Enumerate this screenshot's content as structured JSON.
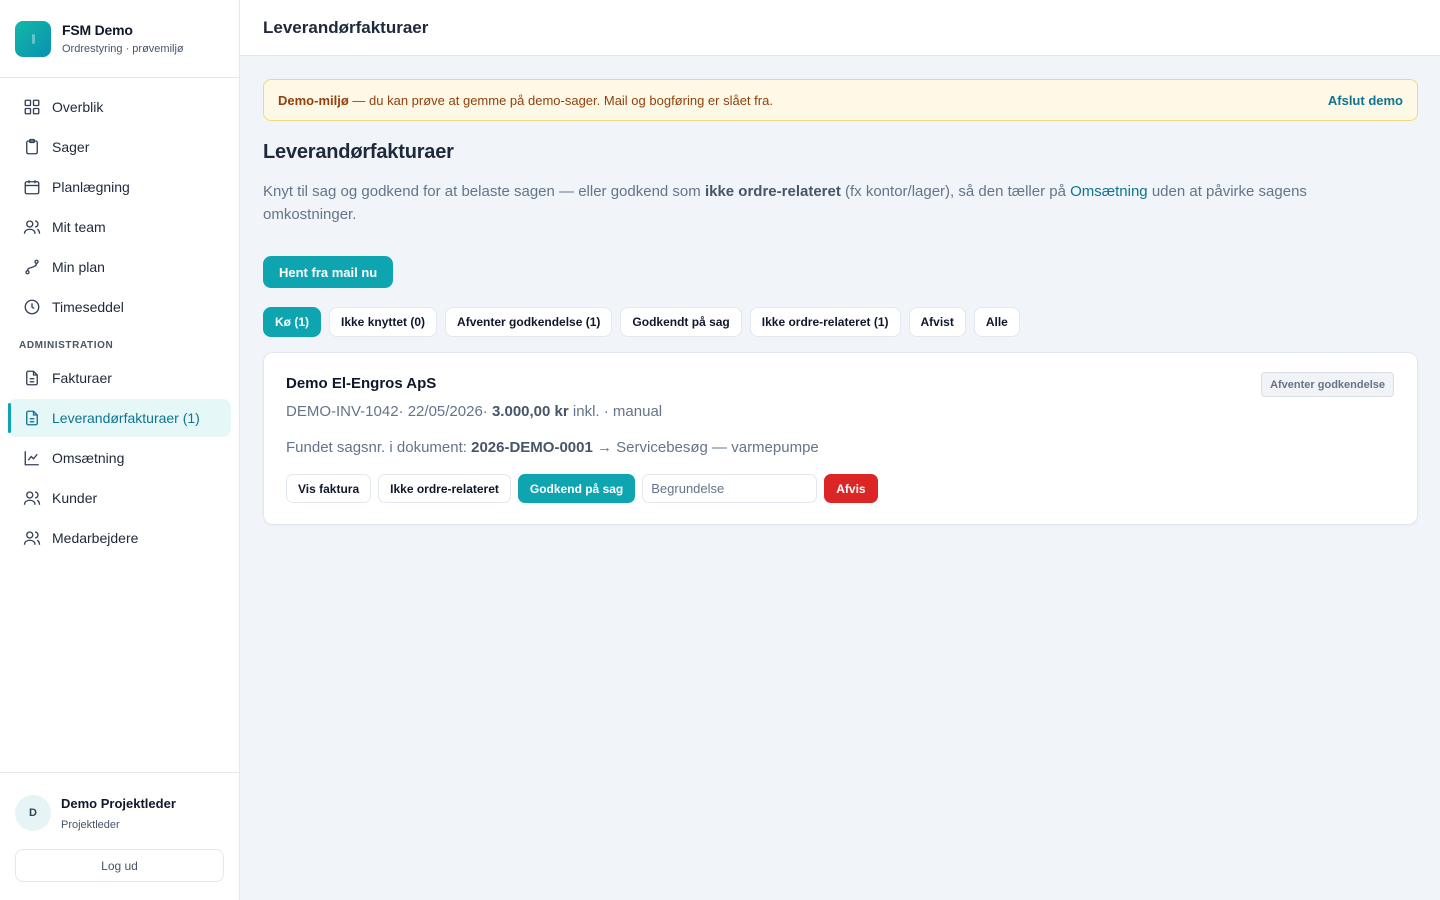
{
  "brand": {
    "title": "FSM Demo",
    "subtitle": "Ordrestyring · prøvemiljø"
  },
  "sidebar": {
    "items": [
      {
        "label": "Overblik",
        "icon": "grid-icon"
      },
      {
        "label": "Sager",
        "icon": "clipboard-icon"
      },
      {
        "label": "Planlægning",
        "icon": "calendar-icon"
      },
      {
        "label": "Mit team",
        "icon": "users-icon"
      },
      {
        "label": "Min plan",
        "icon": "route-icon"
      },
      {
        "label": "Timeseddel",
        "icon": "clock-icon"
      }
    ],
    "admin_heading": "ADMINISTRATION",
    "admin_items": [
      {
        "label": "Fakturaer",
        "icon": "file-icon"
      },
      {
        "label": "Leverandørfakturaer (1)",
        "icon": "file-text-icon",
        "active": true
      },
      {
        "label": "Omsætning",
        "icon": "chart-line-icon"
      },
      {
        "label": "Kunder",
        "icon": "users-icon"
      },
      {
        "label": "Medarbejdere",
        "icon": "users-icon"
      }
    ]
  },
  "user": {
    "initial": "D",
    "name": "Demo Projektleder",
    "role": "Projektleder",
    "logout_label": "Log ud"
  },
  "header": {
    "title": "Leverandørfakturaer"
  },
  "banner": {
    "strong": "Demo-miljø",
    "text": " — du kan prøve at gemme på demo-sager. Mail og bogføring er slået fra.",
    "action": "Afslut demo"
  },
  "page": {
    "title": "Leverandørfakturaer",
    "desc_1": "Knyt til sag og godkend for at belaste sagen — eller godkend som ",
    "desc_bold": "ikke ordre-relateret",
    "desc_2": " (fx kontor/lager), så den tæller på ",
    "desc_link": "Omsætning",
    "desc_3": " uden at påvirke sagens omkostninger.",
    "fetch_button": "Hent fra mail nu"
  },
  "tabs": [
    {
      "label": "Kø (1)",
      "active": true
    },
    {
      "label": "Ikke knyttet (0)"
    },
    {
      "label": "Afventer godkendelse (1)"
    },
    {
      "label": "Godkendt på sag"
    },
    {
      "label": "Ikke ordre-relateret (1)"
    },
    {
      "label": "Afvist"
    },
    {
      "label": "Alle"
    }
  ],
  "invoice": {
    "vendor": "Demo El-Engros ApS",
    "status": "Afventer godkendelse",
    "number": "DEMO-INV-1042",
    "date": "22/05/2026",
    "amount": "3.000,00 kr",
    "amount_suffix": "inkl.",
    "source": "manual",
    "found_label": "Fundet sagsnr. i dokument: ",
    "case_no": "2026-DEMO-0001",
    "case_desc": " → Servicebesøg — varmepumpe",
    "actions": {
      "view": "Vis faktura",
      "not_order": "Ikke ordre-relateret",
      "approve": "Godkend på sag",
      "reason_placeholder": "Begrundelse",
      "reject": "Afvis"
    }
  },
  "colors": {
    "accent": "#0ea5b0",
    "danger": "#dc2626",
    "warning_bg": "#fef9e7"
  }
}
